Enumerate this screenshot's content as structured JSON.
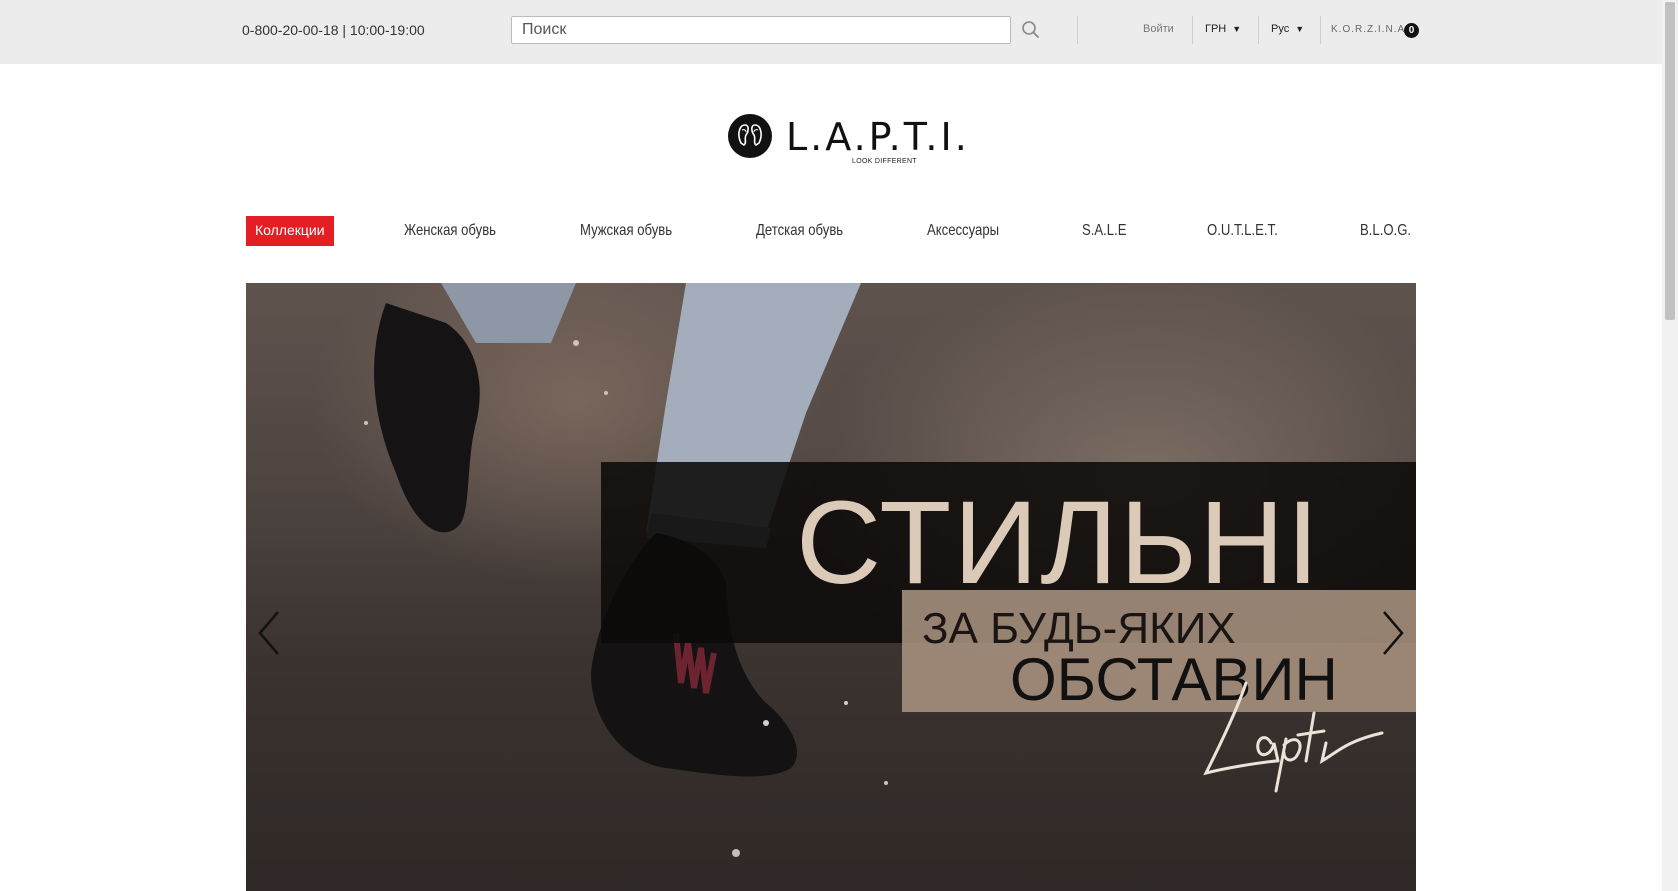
{
  "topbar": {
    "phone": "0-800-20-00-18 | 10:00-19:00",
    "search_placeholder": "Поиск",
    "search_value": "",
    "login": "Войти",
    "currency": "ГРН",
    "language": "Рус",
    "cart_label": "K.O.R.Z.I.N.A.",
    "cart_count": "0"
  },
  "logo": {
    "text": "L.A.P.T.I.",
    "tagline": "LOOK DIFFERENT"
  },
  "nav": {
    "items": [
      {
        "label": "Коллекции"
      },
      {
        "label": "Женская обувь"
      },
      {
        "label": "Мужская обувь"
      },
      {
        "label": "Детская обувь"
      },
      {
        "label": "Аксессуары"
      },
      {
        "label": "S.A.L.E"
      },
      {
        "label": "O.U.T.L.E.T."
      },
      {
        "label": "B.L.O.G."
      }
    ]
  },
  "banner": {
    "title": "СТИЛЬНІ",
    "subtitle_line1": "ЗА БУДЬ-ЯКИХ",
    "subtitle_line2": "ОБСТАВИН",
    "signature": "Lapti"
  },
  "colors": {
    "accent": "#e31e24",
    "topbar_bg": "#ececec",
    "banner_title": "#dccab8"
  },
  "icons": [
    "search-icon",
    "caret-down-icon",
    "arrow-left-icon",
    "arrow-right-icon",
    "logo-mark-icon"
  ]
}
